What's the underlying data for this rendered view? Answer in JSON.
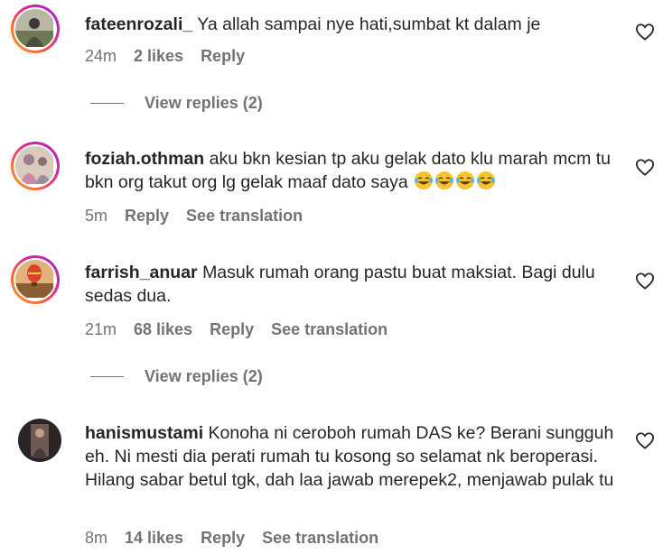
{
  "comments": [
    {
      "username": "fateenrozali_",
      "text": "Ya allah sampai nye hati,sumbat kt dalam je",
      "time": "24m",
      "likes": "2 likes",
      "reply": "Reply",
      "view_replies": "View replies (2)"
    },
    {
      "username": "foziah.othman",
      "text": "aku bkn kesian tp aku gelak dato klu marah mcm tu bkn org takut org lg gelak maaf dato saya",
      "emoji": [
        "face-with-tears-of-joy-icon",
        "face-with-tears-of-joy-icon",
        "face-with-tears-of-joy-icon",
        "face-with-tears-of-joy-icon"
      ],
      "time": "5m",
      "reply": "Reply",
      "translation": "See translation"
    },
    {
      "username": "farrish_anuar",
      "text": "Masuk rumah orang pastu buat maksiat. Bagi dulu sedas dua.",
      "time": "21m",
      "likes": "68 likes",
      "reply": "Reply",
      "translation": "See translation",
      "view_replies": "View replies (2)"
    },
    {
      "username": "hanismustami",
      "text": "Konoha ni ceroboh rumah DAS ke? Berani sungguh eh. Ni mesti dia perati rumah tu kosong so selamat nk beroperasi. Hilang sabar betul tgk, dah laa jawab merepek2, menjawab pulak tu",
      "time": "8m",
      "likes": "14 likes",
      "reply": "Reply",
      "translation": "See translation"
    }
  ],
  "colors": {
    "text": "#262626",
    "secondary": "#737373",
    "story_ring_start": "#f9a825",
    "story_ring_end": "#9b2fc6"
  },
  "icons": {
    "like": "heart-outline-icon"
  }
}
